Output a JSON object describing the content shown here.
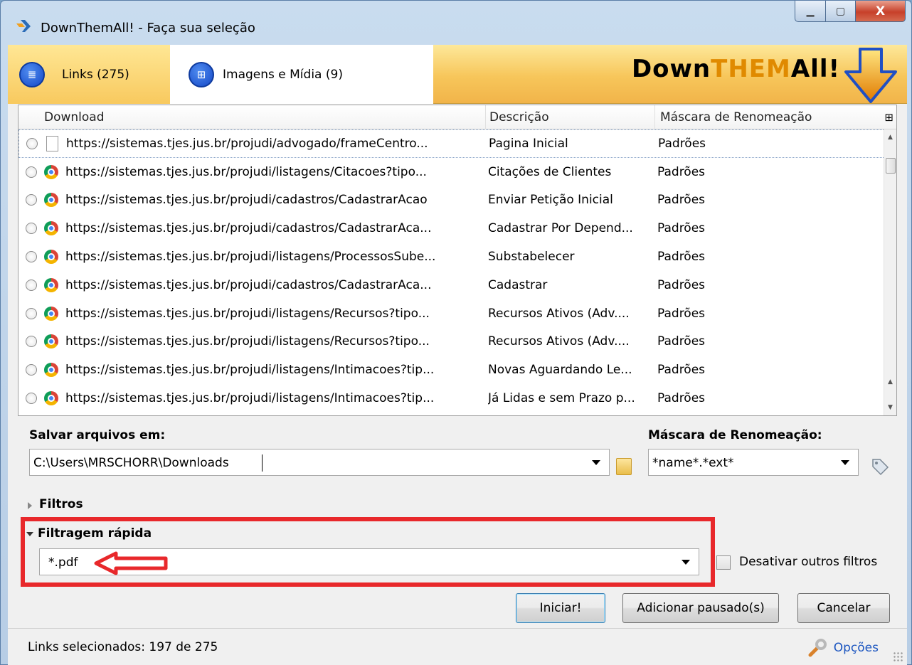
{
  "window": {
    "title": "DownThemAll! - Faça sua seleção",
    "minimize_icon": "minimize-icon",
    "maximize_icon": "maximize-icon",
    "close_icon": "close-icon",
    "min_label": "▁",
    "max_label": "▢",
    "close_label": "X"
  },
  "tabs": [
    {
      "label": "Links (275)",
      "icon": "list-icon",
      "icon_glyph": "≣"
    },
    {
      "label": "Imagens e Mídia (9)",
      "icon": "grid-icon",
      "icon_glyph": "⊞"
    }
  ],
  "logo": {
    "part1": "Down",
    "part2": "THEM",
    "part3": "All!"
  },
  "list": {
    "columns": [
      "Download",
      "Descrição",
      "Máscara de Renomeação"
    ],
    "col_picker_glyph": "⊞",
    "rows": [
      {
        "url": "https://sistemas.tjes.jus.br/projudi/advogado/frameCentro...",
        "desc": "Pagina Inicial",
        "mask": "Padrões",
        "icon": "page"
      },
      {
        "url": "https://sistemas.tjes.jus.br/projudi/listagens/Citacoes?tipo...",
        "desc": "Citações de Clientes",
        "mask": "Padrões",
        "icon": "chrome"
      },
      {
        "url": "https://sistemas.tjes.jus.br/projudi/cadastros/CadastrarAcao",
        "desc": "Enviar Petição Inicial",
        "mask": "Padrões",
        "icon": "chrome"
      },
      {
        "url": "https://sistemas.tjes.jus.br/projudi/cadastros/CadastrarAca...",
        "desc": "Cadastrar Por Depend...",
        "mask": "Padrões",
        "icon": "chrome"
      },
      {
        "url": "https://sistemas.tjes.jus.br/projudi/listagens/ProcessosSube...",
        "desc": "Substabelecer",
        "mask": "Padrões",
        "icon": "chrome"
      },
      {
        "url": "https://sistemas.tjes.jus.br/projudi/cadastros/CadastrarAca...",
        "desc": "Cadastrar",
        "mask": "Padrões",
        "icon": "chrome"
      },
      {
        "url": "https://sistemas.tjes.jus.br/projudi/listagens/Recursos?tipo...",
        "desc": "Recursos Ativos  (Adv....",
        "mask": "Padrões",
        "icon": "chrome"
      },
      {
        "url": "https://sistemas.tjes.jus.br/projudi/listagens/Recursos?tipo...",
        "desc": "Recursos Ativos  (Adv....",
        "mask": "Padrões",
        "icon": "chrome"
      },
      {
        "url": "https://sistemas.tjes.jus.br/projudi/listagens/Intimacoes?tip...",
        "desc": "Novas Aguardando Le...",
        "mask": "Padrões",
        "icon": "chrome"
      },
      {
        "url": "https://sistemas.tjes.jus.br/projudi/listagens/Intimacoes?tip...",
        "desc": "Já Lidas e sem Prazo p...",
        "mask": "Padrões",
        "icon": "chrome"
      }
    ]
  },
  "save": {
    "label": "Salvar arquivos em:",
    "value": "C:\\Users\\MRSCHORR\\Downloads"
  },
  "mask": {
    "label": "Máscara de Renomeação:",
    "value": "*name*.*ext*"
  },
  "filters": {
    "label": "Filtros"
  },
  "quick_filter": {
    "label": "Filtragem rápida",
    "value": "*.pdf"
  },
  "disable_others": {
    "label": "Desativar outros filtros",
    "checked": false
  },
  "buttons": {
    "start": "Iniciar!",
    "add_paused": "Adicionar pausado(s)",
    "cancel": "Cancelar"
  },
  "status": {
    "text": "Links selecionados: 197 de 275",
    "options": "Opções"
  },
  "colors": {
    "tabs_bg": "#f7c65a",
    "annotation_red": "#e8282b",
    "link_blue": "#1c56c0"
  }
}
